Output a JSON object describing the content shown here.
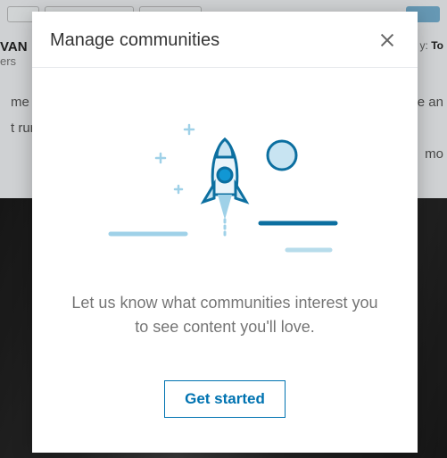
{
  "bg": {
    "name_top": "VAN",
    "name_sub": "ers",
    "line1_pre": "me",
    "line1_post": "e an",
    "line2_pre": "t run",
    "line3_post": "mo",
    "sort_pre": "y:",
    "sort_val": "To"
  },
  "modal": {
    "title": "Manage communities",
    "body_text": "Let us know what communities interest you to see content you'll love.",
    "cta_label": "Get started"
  }
}
